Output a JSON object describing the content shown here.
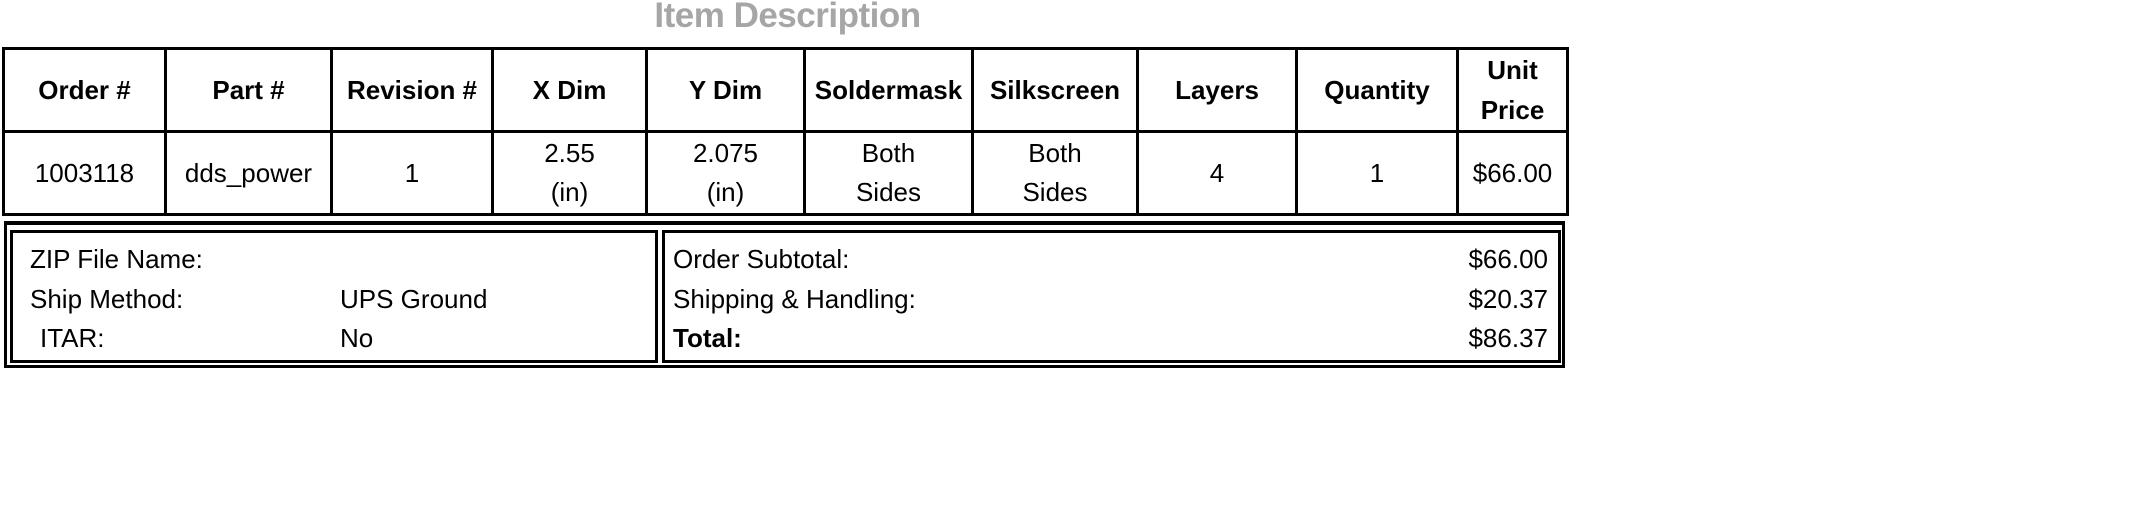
{
  "title": "Item Description",
  "table": {
    "headers": [
      {
        "line1": "Order #",
        "line2": ""
      },
      {
        "line1": "Part #",
        "line2": ""
      },
      {
        "line1": "Revision #",
        "line2": ""
      },
      {
        "line1": "X Dim",
        "line2": ""
      },
      {
        "line1": "Y Dim",
        "line2": ""
      },
      {
        "line1": "Soldermask",
        "line2": ""
      },
      {
        "line1": "Silkscreen",
        "line2": ""
      },
      {
        "line1": "Layers",
        "line2": ""
      },
      {
        "line1": "Quantity",
        "line2": ""
      },
      {
        "line1": "Unit",
        "line2": "Price"
      }
    ],
    "row": [
      {
        "line1": "1003118",
        "line2": ""
      },
      {
        "line1": "dds_power",
        "line2": ""
      },
      {
        "line1": "1",
        "line2": ""
      },
      {
        "line1": "2.55",
        "line2": "(in)"
      },
      {
        "line1": "2.075",
        "line2": "(in)"
      },
      {
        "line1": "Both",
        "line2": "Sides"
      },
      {
        "line1": "Both",
        "line2": "Sides"
      },
      {
        "line1": "4",
        "line2": ""
      },
      {
        "line1": "1",
        "line2": ""
      },
      {
        "line1": "$66.00",
        "line2": ""
      }
    ]
  },
  "file_info": {
    "zip_label": "ZIP File Name:",
    "zip_value": "",
    "ship_label": "Ship Method:",
    "ship_value": "UPS Ground",
    "itar_label": "ITAR:",
    "itar_value": "No"
  },
  "totals": {
    "subtotal_label": "Order Subtotal:",
    "subtotal_value": "$66.00",
    "shipping_label": "Shipping & Handling:",
    "shipping_value": "$20.37",
    "total_label": "Total:",
    "total_value": "$86.37"
  }
}
